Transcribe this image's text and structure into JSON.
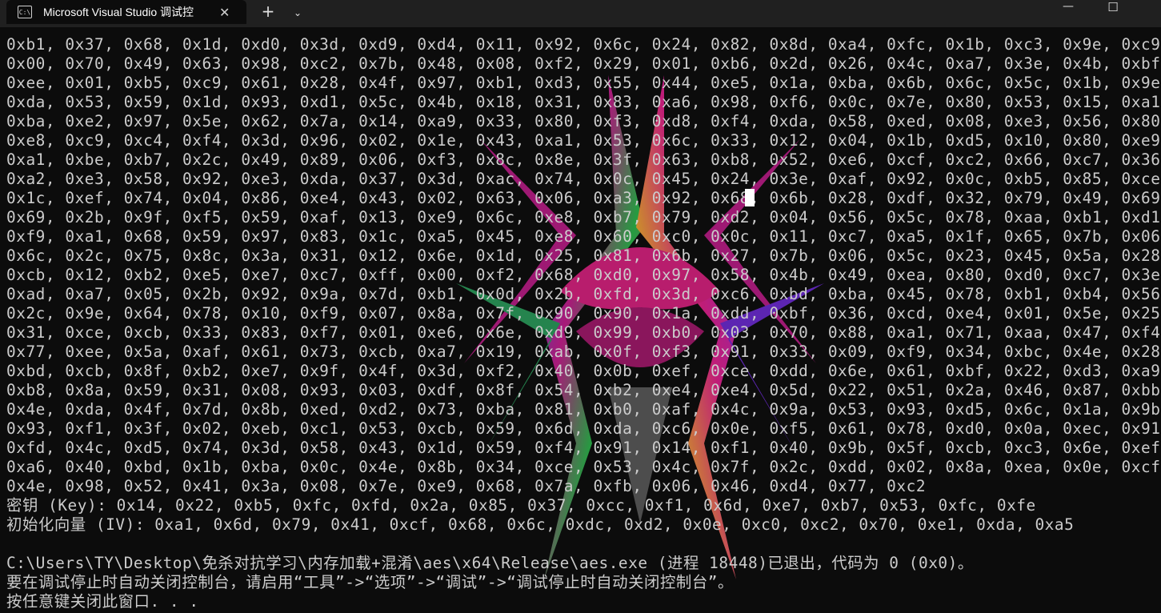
{
  "window": {
    "tab_icon_text": "C:\\",
    "tab_title": "Microsoft Visual Studio 调试控",
    "icons": [
      "terminal-icon",
      "close-icon",
      "plus-icon",
      "chevron-down-icon",
      "minimize-icon",
      "maximize-icon"
    ]
  },
  "console": {
    "lines": [
      "0xb1, 0x37, 0x68, 0x1d, 0xd0, 0x3d, 0xd9, 0xd4, 0x11, 0x92, 0x6c, 0x24, 0x82, 0x8d, 0xa4, 0xfc, 0x1b, 0xc3, 0x9e, 0xc9,",
      "0x00, 0x70, 0x49, 0x63, 0x98, 0xc2, 0x7b, 0x48, 0x08, 0xf2, 0x29, 0x01, 0xb6, 0x2d, 0x26, 0x4c, 0xa7, 0x3e, 0x4b, 0xbf,",
      "0xee, 0x01, 0xb5, 0xc9, 0x61, 0x28, 0x4f, 0x97, 0xb1, 0xd3, 0x55, 0x44, 0xe5, 0x1a, 0xba, 0x6b, 0x6c, 0x5c, 0x1b, 0x9e,",
      "0xda, 0x53, 0x59, 0x1d, 0x93, 0xd1, 0x5c, 0x4b, 0x18, 0x31, 0x83, 0xa6, 0x98, 0xf6, 0x0c, 0x7e, 0x80, 0x53, 0x15, 0xa1,",
      "0xba, 0xe2, 0x97, 0x5e, 0x62, 0x7a, 0x14, 0xa9, 0x33, 0x80, 0xf3, 0xd8, 0xf4, 0xda, 0x58, 0xed, 0x08, 0xe3, 0x56, 0x80,",
      "0xe8, 0xc9, 0xc4, 0xf4, 0x3d, 0x96, 0x02, 0x1e, 0x43, 0xa1, 0x53, 0x6c, 0x33, 0x12, 0x04, 0x1b, 0xd5, 0x10, 0x80, 0xe9,",
      "0xa1, 0xbe, 0xb7, 0x2c, 0x49, 0x89, 0x06, 0xf3, 0x8c, 0x8e, 0x3f, 0x63, 0xb8, 0x52, 0xe6, 0xcf, 0xc2, 0x66, 0xc7, 0x36,",
      "0xa2, 0xe3, 0x58, 0x92, 0xe3, 0xda, 0x37, 0x3d, 0xac, 0x74, 0x0c, 0x45, 0x24, 0x3e, 0xaf, 0x92, 0x0c, 0xb5, 0x85, 0xce,",
      "0x1c, 0xef, 0x74, 0x04, 0x86, 0xe4, 0x43, 0x02, 0x63, 0x06, 0xa3, 0x92, 0x68, 0x6b, 0x28, 0xdf, 0x32, 0x79, 0x49, 0x69,",
      "0x69, 0x2b, 0x9f, 0xf5, 0x59, 0xaf, 0x13, 0xe9, 0x6c, 0xe8, 0xb7, 0x79, 0xd2, 0x04, 0x56, 0x5c, 0x78, 0xaa, 0xb1, 0xd1,",
      "0xf9, 0xa1, 0x68, 0x59, 0x97, 0x83, 0x1c, 0xa5, 0x45, 0xe8, 0x60, 0xc0, 0x0c, 0x11, 0xc7, 0xa5, 0x1f, 0x65, 0x7b, 0x06,",
      "0x6c, 0x2c, 0x75, 0x8c, 0x3a, 0x31, 0x12, 0x6e, 0x1d, 0x25, 0x81, 0x6b, 0x27, 0x7b, 0x06, 0x5c, 0x23, 0x45, 0x5a, 0x28,",
      "0xcb, 0x12, 0xb2, 0xe5, 0xe7, 0xc7, 0xff, 0x00, 0xf2, 0x68, 0xd0, 0x97, 0x58, 0x4b, 0x49, 0xea, 0x80, 0xd0, 0xc7, 0x3e,",
      "0xad, 0xa7, 0x05, 0x2b, 0x92, 0x9a, 0x7d, 0xb1, 0x0d, 0x2b, 0xfd, 0x3d, 0xc6, 0xbd, 0xba, 0x45, 0x78, 0xb1, 0xb4, 0x56,",
      "0x2c, 0x9e, 0x64, 0x78, 0x10, 0xf9, 0x07, 0x8a, 0x7f, 0x90, 0x90, 0x1a, 0xdd, 0xbf, 0x36, 0xcd, 0xe4, 0x01, 0x5e, 0x25,",
      "0x31, 0xce, 0xcb, 0x33, 0x83, 0xf7, 0x01, 0xe6, 0x6e, 0xd9, 0x99, 0xb0, 0x03, 0x70, 0x88, 0xa1, 0x71, 0xaa, 0x47, 0xf4,",
      "0x77, 0xee, 0x5a, 0xaf, 0x61, 0x73, 0xcb, 0xa7, 0x19, 0xab, 0x0f, 0xf3, 0x91, 0x33, 0x09, 0xf9, 0x34, 0xbc, 0x4e, 0x28,",
      "0xbd, 0xcb, 0x8f, 0xb2, 0xe7, 0x9f, 0x4f, 0x3d, 0xf2, 0x40, 0x0b, 0xef, 0xce, 0xdd, 0x6e, 0x61, 0xbf, 0x22, 0xd3, 0xa9,",
      "0xb8, 0x8a, 0x59, 0x31, 0x08, 0x93, 0x03, 0xdf, 0x8f, 0x54, 0xb2, 0xe4, 0xe4, 0x5d, 0x22, 0x51, 0x2a, 0x46, 0x87, 0xbb,",
      "0x4e, 0xda, 0x4f, 0x7d, 0x8b, 0xed, 0xd2, 0x73, 0xba, 0x81, 0xb0, 0xaf, 0x4c, 0x9a, 0x53, 0x93, 0xd5, 0x6c, 0x1a, 0x9b,",
      "0x93, 0xf1, 0x3f, 0x02, 0xeb, 0xc1, 0x53, 0xcb, 0x59, 0x6d, 0xda, 0xc6, 0x0e, 0xf5, 0x61, 0x78, 0xd0, 0x0a, 0xec, 0x91,",
      "0xfd, 0x4c, 0xd5, 0x74, 0x3d, 0x58, 0x43, 0x1d, 0x59, 0xf4, 0x91, 0x14, 0xf1, 0x40, 0x9b, 0x5f, 0xcb, 0xc3, 0x6e, 0xef,",
      "0xa6, 0x40, 0xbd, 0x1b, 0xba, 0x0c, 0x4e, 0x8b, 0x34, 0xce, 0x53, 0x4c, 0x7f, 0x2c, 0xdd, 0x02, 0x8a, 0xea, 0x0e, 0xcf,",
      "0x4e, 0x98, 0x52, 0x41, 0x3a, 0x08, 0x7e, 0xe9, 0x68, 0x7a, 0xfb, 0x06, 0x46, 0xd4, 0x77, 0xc2",
      "密钥 (Key): 0x14, 0x22, 0xb5, 0xfc, 0xfd, 0x2a, 0x85, 0x37, 0xcc, 0xf1, 0x6d, 0xe7, 0xb7, 0x53, 0xfc, 0xfe",
      "初始化向量 (IV): 0xa1, 0x6d, 0x79, 0x41, 0xcf, 0x68, 0x6c, 0xdc, 0xd2, 0x0e, 0xc0, 0xc2, 0x70, 0xe1, 0xda, 0xa5",
      "",
      "C:\\Users\\TY\\Desktop\\免杀对抗学习\\内存加载+混淆\\aes\\x64\\Release\\aes.exe (进程 18448)已退出，代码为 0 (0x0)。",
      "要在调试停止时自动关闭控制台，请启用“工具”->“选项”->“调试”->“调试停止时自动关闭控制台”。",
      "按任意键关闭此窗口. . ."
    ]
  }
}
